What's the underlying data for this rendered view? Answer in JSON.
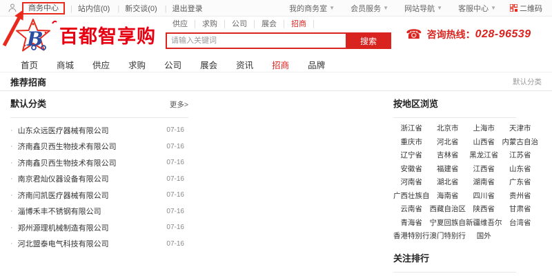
{
  "topbar": {
    "business_center": "商务中心",
    "left_items": [
      "站内信(0)",
      "新交谈(0)",
      "退出登录"
    ],
    "right_items": [
      "我的商务室",
      "会员服务",
      "网站导航",
      "客服中心"
    ],
    "qr_label": "二维码"
  },
  "header": {
    "logo_text": "百都智享购",
    "quick_links": [
      {
        "label": "供应",
        "active": false
      },
      {
        "label": "求购",
        "active": false
      },
      {
        "label": "公司",
        "active": false
      },
      {
        "label": "展会",
        "active": false
      },
      {
        "label": "招商",
        "active": true
      }
    ],
    "search": {
      "placeholder": "请输入关键词",
      "button_label": "搜索"
    },
    "hotline": {
      "label": "咨询热线：",
      "number": "028-96539"
    }
  },
  "nav": {
    "items": [
      {
        "label": "首页",
        "active": false
      },
      {
        "label": "商城",
        "active": false
      },
      {
        "label": "供应",
        "active": false
      },
      {
        "label": "求购",
        "active": false
      },
      {
        "label": "公司",
        "active": false
      },
      {
        "label": "展会",
        "active": false
      },
      {
        "label": "资讯",
        "active": false
      },
      {
        "label": "招商",
        "active": true
      },
      {
        "label": "品牌",
        "active": false
      }
    ]
  },
  "section": {
    "title": "推荐招商",
    "right_label": "默认分类"
  },
  "left_panel": {
    "title": "默认分类",
    "more_label": "更多>",
    "items": [
      {
        "name": "山东众远医疗器械有限公司",
        "date": "07-16"
      },
      {
        "name": "济南鑫贝西生物技术有限公司",
        "date": "07-16"
      },
      {
        "name": "济南鑫贝西生物技术有限公司",
        "date": "07-16"
      },
      {
        "name": "南京君灿仪器设备有限公司",
        "date": "07-16"
      },
      {
        "name": "济南闫凯医疗器械有限公司",
        "date": "07-16"
      },
      {
        "name": "淄博禾丰不锈钢有限公司",
        "date": "07-16"
      },
      {
        "name": "郑州源理机械制造有限公司",
        "date": "07-16"
      },
      {
        "name": "河北盟泰电气科技有限公司",
        "date": "07-16"
      }
    ]
  },
  "region_panel": {
    "title": "按地区浏览",
    "regions": [
      "浙江省",
      "北京市",
      "上海市",
      "天津市",
      "重庆市",
      "河北省",
      "山西省",
      "内蒙古自治",
      "辽宁省",
      "吉林省",
      "黑龙江省",
      "江苏省",
      "安徽省",
      "福建省",
      "江西省",
      "山东省",
      "河南省",
      "湖北省",
      "湖南省",
      "广东省",
      "广西壮族自",
      "海南省",
      "四川省",
      "贵州省",
      "云南省",
      "西藏自治区",
      "陕西省",
      "甘肃省",
      "青海省",
      "宁夏回族自",
      "新疆维吾尔",
      "台湾省",
      "香港特别行",
      "澳门特别行",
      "国外"
    ]
  },
  "follow_panel": {
    "title": "关注排行"
  },
  "colors": {
    "accent": "#d9231f",
    "logo_red": "#e60012",
    "annotation_red": "#e8291c"
  }
}
